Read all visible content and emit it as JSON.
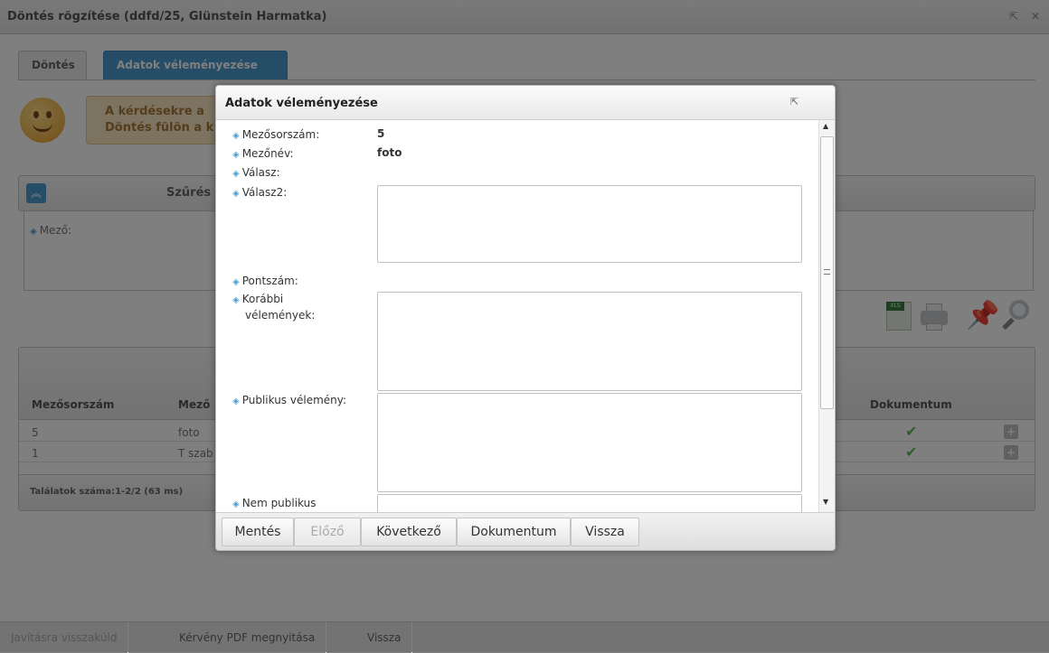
{
  "window": {
    "title": "Döntés rögzítése (ddfd/25, Glünstein Harmatka)",
    "tabs": [
      {
        "label": "Döntés"
      },
      {
        "label": "Adatok véleményezése"
      }
    ]
  },
  "notice": {
    "line1": "A kérdésekre a",
    "line2": "Döntés fülön a k"
  },
  "filter": {
    "title": "Szűrés",
    "field_label": "Mező:"
  },
  "grid": {
    "columns": [
      "Mezősorszám",
      "Mező",
      "Dokumentum"
    ],
    "rows": [
      {
        "num": "5",
        "field": "foto"
      },
      {
        "num": "1",
        "field": "T szab"
      }
    ],
    "footer": "Találatok száma:1-2/2 (63 ms)"
  },
  "bottom_bar": {
    "buttons": [
      "Javításra visszaküld",
      "Kérvény PDF megnyitása",
      "Vissza"
    ]
  },
  "dialog": {
    "title": "Adatok véleményezése",
    "fields": {
      "field_number": {
        "label": "Mezősorszám:",
        "value": "5"
      },
      "field_name": {
        "label": "Mezőnév:",
        "value": "foto"
      },
      "answer": {
        "label": "Válasz:"
      },
      "answer2": {
        "label": "Válasz2:"
      },
      "score": {
        "label": "Pontszám:"
      },
      "previous_opinions": {
        "label_line1": "Korábbi",
        "label_line2": "vélemények:"
      },
      "public_opinion": {
        "label": "Publikus vélemény:"
      },
      "non_public": {
        "label": "Nem publikus"
      }
    },
    "buttons": {
      "save": "Mentés",
      "previous": "Előző",
      "next": "Következő",
      "document": "Dokumentum",
      "back": "Vissza"
    }
  }
}
